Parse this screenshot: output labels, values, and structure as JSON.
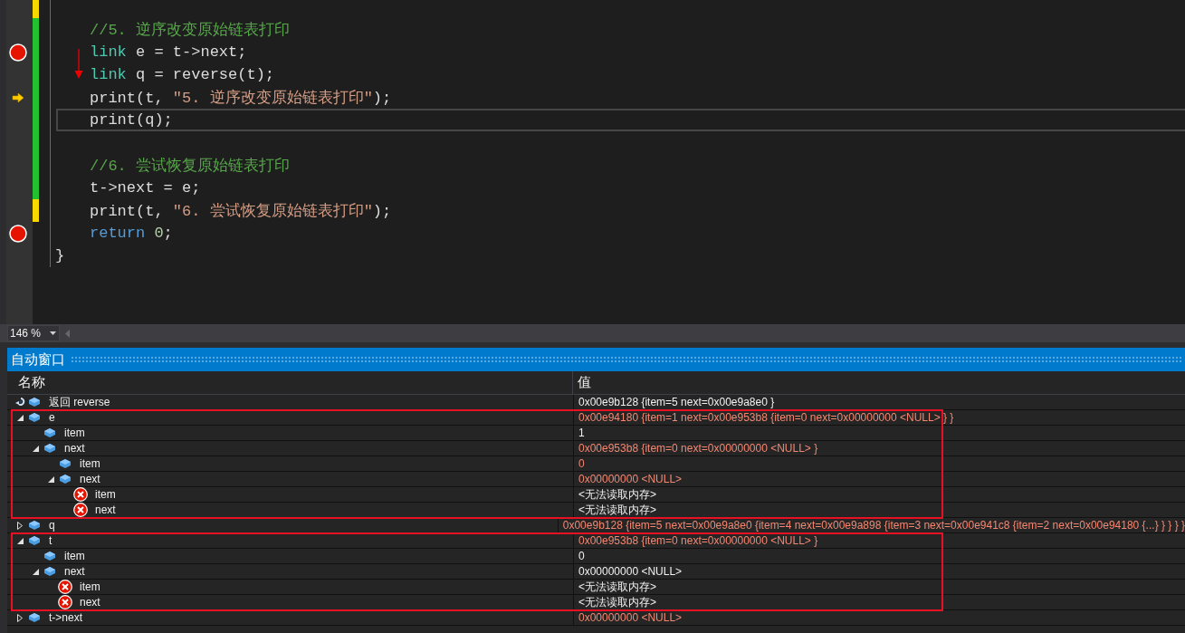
{
  "editor": {
    "lines": [
      {
        "changed": true,
        "saved": false,
        "breakpoint": false,
        "current": false,
        "caret": false,
        "annotation_arrow": false
      },
      {
        "tokens": [
          {
            "text": "//5. 逆序改变原始链表打印",
            "kind": "comment"
          }
        ],
        "changed": true,
        "saved": true,
        "breakpoint": false,
        "current": false,
        "caret": false,
        "annotation_arrow": false
      },
      {
        "tokens": [
          {
            "text": "link",
            "kind": "type"
          },
          {
            "text": " e = t->next;",
            "kind": "plain"
          }
        ],
        "changed": true,
        "saved": true,
        "breakpoint": true,
        "current": false,
        "caret": false,
        "annotation_arrow": true
      },
      {
        "tokens": [
          {
            "text": "link",
            "kind": "type"
          },
          {
            "text": " q = reverse(t);",
            "kind": "plain"
          }
        ],
        "changed": true,
        "saved": true,
        "breakpoint": false,
        "current": false,
        "caret": false,
        "annotation_arrow": false
      },
      {
        "tokens": [
          {
            "text": "print(t, ",
            "kind": "plain"
          },
          {
            "text": "\"5. 逆序改变原始链表打印\"",
            "kind": "string"
          },
          {
            "text": ");",
            "kind": "plain"
          }
        ],
        "changed": true,
        "saved": true,
        "breakpoint": false,
        "current": true,
        "caret": false,
        "annotation_arrow": false
      },
      {
        "tokens": [
          {
            "text": "print(q);",
            "kind": "plain"
          }
        ],
        "changed": true,
        "saved": true,
        "breakpoint": false,
        "current": false,
        "caret": true,
        "annotation_arrow": false
      },
      {
        "changed": true,
        "saved": true,
        "breakpoint": false,
        "current": false,
        "caret": false,
        "annotation_arrow": false
      },
      {
        "tokens": [
          {
            "text": "//6. 尝试恢复原始链表打印",
            "kind": "comment"
          }
        ],
        "changed": true,
        "saved": true,
        "breakpoint": false,
        "current": false,
        "caret": false,
        "annotation_arrow": false
      },
      {
        "tokens": [
          {
            "text": "t->next = e;",
            "kind": "plain"
          }
        ],
        "changed": true,
        "saved": true,
        "breakpoint": false,
        "current": false,
        "caret": false,
        "annotation_arrow": false
      },
      {
        "tokens": [
          {
            "text": "print(t, ",
            "kind": "plain"
          },
          {
            "text": "\"6. 尝试恢复原始链表打印\"",
            "kind": "string"
          },
          {
            "text": ");",
            "kind": "plain"
          }
        ],
        "changed": true,
        "saved": false,
        "breakpoint": false,
        "current": false,
        "caret": false,
        "annotation_arrow": false
      },
      {
        "tokens": [
          {
            "text": "return",
            "kind": "keyword"
          },
          {
            "text": "0",
            "kind": "number",
            "space_before": true
          },
          {
            "text": ";",
            "kind": "plain"
          }
        ],
        "changed": false,
        "breakpoint": true,
        "current": false,
        "caret": false,
        "annotation_arrow": false
      }
    ],
    "closing": "}"
  },
  "zoom": {
    "value": "146 %"
  },
  "autos": {
    "title": "自动窗口",
    "columns": [
      "名称",
      "值"
    ],
    "rows": [
      {
        "kind": "return",
        "name": "返回 reverse",
        "value": "0x00e9b128 {item=5 next=0x00e9a8e0 }",
        "changed": false,
        "framed": false
      },
      {
        "kind": "field",
        "name": "e",
        "value": "0x00e94180 {item=1 next=0x00e953b8 {item=0 next=0x00000000 <NULL> } }",
        "changed": true,
        "expandable": true,
        "expanded": true,
        "framed": true,
        "children": [
          {
            "kind": "field",
            "name": "item",
            "value": "1",
            "changed": false,
            "expandable": false,
            "expanded": false
          },
          {
            "kind": "field",
            "name": "next",
            "value": "0x00e953b8 {item=0 next=0x00000000 <NULL> }",
            "changed": true,
            "expandable": true,
            "expanded": true,
            "children": [
              {
                "kind": "field",
                "name": "item",
                "value": "0",
                "changed": true,
                "expandable": false,
                "expanded": false
              },
              {
                "kind": "field",
                "name": "next",
                "value": "0x00000000 <NULL>",
                "changed": true,
                "expandable": true,
                "expanded": true,
                "children": [
                  {
                    "kind": "error",
                    "name": "item",
                    "value": "<无法读取内存>",
                    "changed": false,
                    "expandable": false,
                    "expanded": false
                  },
                  {
                    "kind": "error",
                    "name": "next",
                    "value": "<无法读取内存>",
                    "changed": false,
                    "expandable": false,
                    "expanded": false
                  }
                ]
              }
            ]
          }
        ]
      },
      {
        "kind": "field",
        "name": "q",
        "value": "0x00e9b128 {item=5 next=0x00e9a8e0 {item=4 next=0x00e9a898 {item=3 next=0x00e941c8 {item=2 next=0x00e94180 {...} } } } }",
        "changed": true,
        "expandable": true,
        "expanded": false,
        "framed": false
      },
      {
        "kind": "field",
        "name": "t",
        "value": "0x00e953b8 {item=0 next=0x00000000 <NULL> }",
        "changed": true,
        "expandable": true,
        "expanded": true,
        "framed": true,
        "children": [
          {
            "kind": "field",
            "name": "item",
            "value": "0",
            "changed": false,
            "expandable": false,
            "expanded": false
          },
          {
            "kind": "field",
            "name": "next",
            "value": "0x00000000 <NULL>",
            "changed": false,
            "expandable": true,
            "expanded": true,
            "children": [
              {
                "kind": "error",
                "name": "item",
                "value": "<无法读取内存>",
                "changed": false,
                "expandable": false,
                "expanded": false
              },
              {
                "kind": "error",
                "name": "next",
                "value": "<无法读取内存>",
                "changed": false,
                "expandable": false,
                "expanded": false
              }
            ]
          }
        ]
      },
      {
        "kind": "field",
        "name": "t->next",
        "value": "0x00000000 <NULL>",
        "changed": true,
        "expandable": true,
        "expanded": false,
        "framed": false
      }
    ]
  }
}
